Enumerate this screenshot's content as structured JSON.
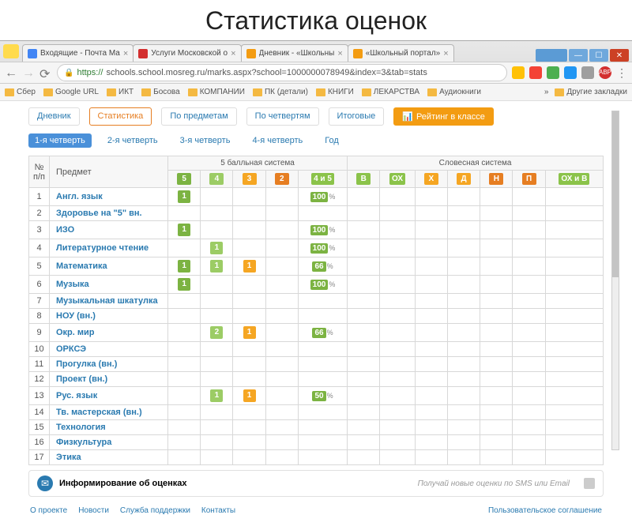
{
  "page_title": "Статистика оценок",
  "browser": {
    "tabs": [
      {
        "label": "Входящие - Почта Ма",
        "color": "#4285f4"
      },
      {
        "label": "Услуги Московской о",
        "color": "#d32f2f"
      },
      {
        "label": "Дневник - «Школьны",
        "color": "#f39c12"
      },
      {
        "label": "«Школьный портал»",
        "color": "#f39c12"
      }
    ],
    "url_prefix": "https://",
    "url": "schools.school.mosreg.ru/marks.aspx?school=1000000078949&index=3&tab=stats",
    "bookmarks": [
      "Сбер",
      "Google URL",
      "ИКТ",
      "Босова",
      "КОМПАНИИ",
      "ПК (детали)",
      "КНИГИ",
      "ЛЕКАРСТВА",
      "Аудиокниги"
    ],
    "other_bookmarks": "Другие закладки"
  },
  "main_tabs": [
    "Дневник",
    "Статистика",
    "По предметам",
    "По четвертям",
    "Итоговые"
  ],
  "main_tab_active": 1,
  "rating_tab": "Рейтинг в классе",
  "sub_tabs": [
    "1-я четверть",
    "2-я четверть",
    "3-я четверть",
    "4-я четверть",
    "Год"
  ],
  "sub_tab_active": 0,
  "table": {
    "col_num": "№ п/п",
    "col_subject": "Предмет",
    "group_5ball": "5 балльная система",
    "group_word": "Словесная система",
    "headers_5": [
      {
        "t": "5",
        "c": "#7cb342"
      },
      {
        "t": "4",
        "c": "#9ccc65"
      },
      {
        "t": "3",
        "c": "#f5a623"
      },
      {
        "t": "2",
        "c": "#e67e22"
      },
      {
        "t": "4 и 5",
        "c": "#8bc34a"
      }
    ],
    "headers_word": [
      {
        "t": "В",
        "c": "#8bc34a"
      },
      {
        "t": "ОХ",
        "c": "#8bc34a"
      },
      {
        "t": "Х",
        "c": "#f5a623"
      },
      {
        "t": "Д",
        "c": "#f5a623"
      },
      {
        "t": "Н",
        "c": "#e67e22"
      },
      {
        "t": "П",
        "c": "#e67e22"
      },
      {
        "t": "ОХ и В",
        "c": "#8bc34a"
      }
    ],
    "rows": [
      {
        "n": 1,
        "subj": "Англ. язык",
        "g5": "1",
        "pct": "100"
      },
      {
        "n": 2,
        "subj": "Здоровье на \"5\" вн."
      },
      {
        "n": 3,
        "subj": "ИЗО",
        "g5": "1",
        "pct": "100"
      },
      {
        "n": 4,
        "subj": "Литературное чтение",
        "g4": "1",
        "pct": "100"
      },
      {
        "n": 5,
        "subj": "Математика",
        "g5": "1",
        "g4": "1",
        "g3": "1",
        "pct": "66"
      },
      {
        "n": 6,
        "subj": "Музыка",
        "g5": "1",
        "pct": "100"
      },
      {
        "n": 7,
        "subj": "Музыкальная шкатулка"
      },
      {
        "n": 8,
        "subj": "НОУ (вн.)"
      },
      {
        "n": 9,
        "subj": "Окр. мир",
        "g4": "2",
        "g3": "1",
        "pct": "66"
      },
      {
        "n": 10,
        "subj": "ОРКСЭ"
      },
      {
        "n": 11,
        "subj": "Прогулка (вн.)"
      },
      {
        "n": 12,
        "subj": "Проект (вн.)"
      },
      {
        "n": 13,
        "subj": "Рус. язык",
        "g4": "1",
        "g3": "1",
        "pct": "50"
      },
      {
        "n": 14,
        "subj": "Тв. мастерская (вн.)"
      },
      {
        "n": 15,
        "subj": "Технология"
      },
      {
        "n": 16,
        "subj": "Физкультура"
      },
      {
        "n": 17,
        "subj": "Этика"
      }
    ]
  },
  "info_bar": {
    "title": "Информирование об оценках",
    "subtitle": "Получай новые оценки по SMS или Email"
  },
  "footer": [
    "О проекте",
    "Новости",
    "Служба поддержки",
    "Контакты"
  ],
  "footer_right": "Пользовательское соглашение"
}
